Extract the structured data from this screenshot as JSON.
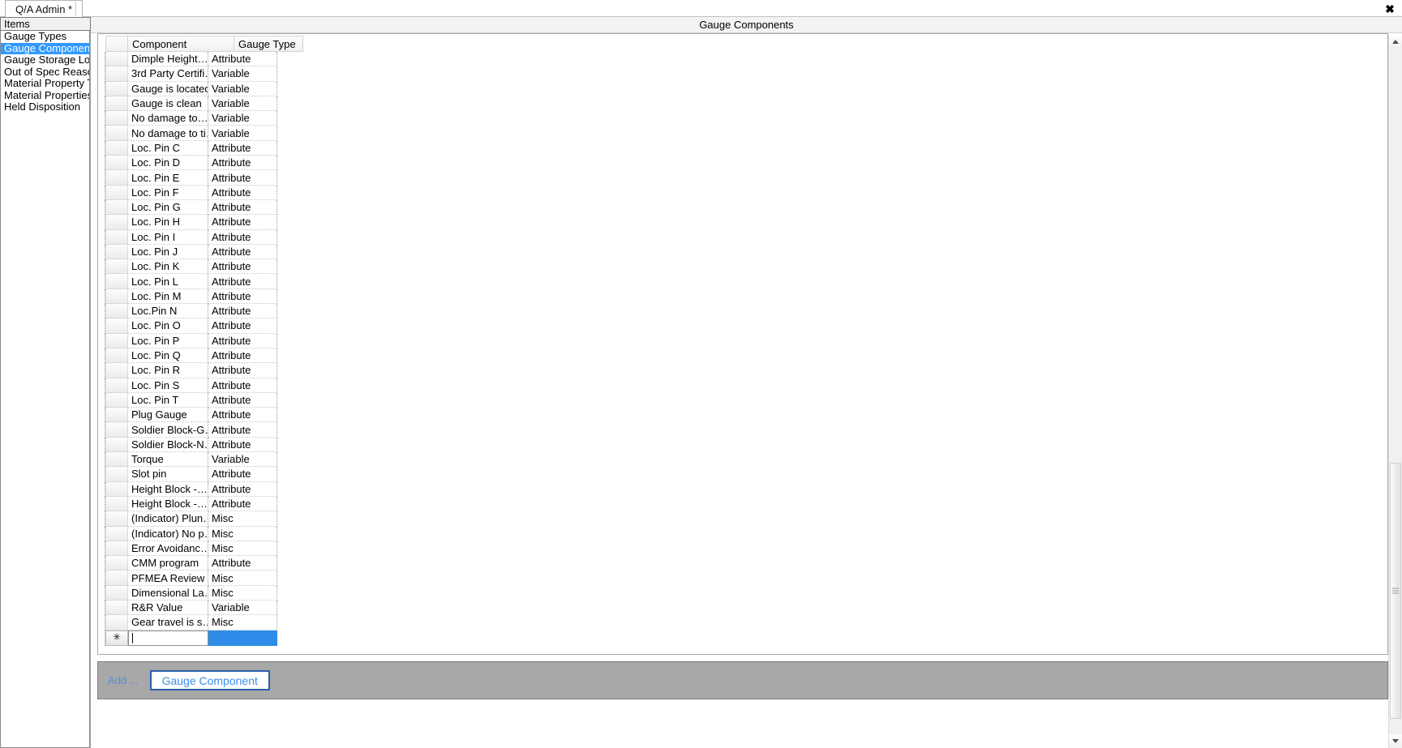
{
  "window": {
    "app_tab_label": "Q/A Admin *",
    "close_icon": "close-icon"
  },
  "sidebar": {
    "header": "Items",
    "items": [
      {
        "label": "Gauge Types",
        "selected": false
      },
      {
        "label": "Gauge Components",
        "selected": true
      },
      {
        "label": "Gauge Storage Loc",
        "selected": false
      },
      {
        "label": "Out of Spec Reason",
        "selected": false
      },
      {
        "label": "Material Property Ty",
        "selected": false
      },
      {
        "label": "Material Properties",
        "selected": false
      },
      {
        "label": "Held Disposition",
        "selected": false
      }
    ]
  },
  "main": {
    "title": "Gauge Components",
    "grid": {
      "columns": [
        "Component",
        "Gauge Type"
      ],
      "rows": [
        {
          "component": "Dimple  Height…",
          "gauge_type": "Attribute"
        },
        {
          "component": "3rd Party  Certifi…",
          "gauge_type": "Variable"
        },
        {
          "component": "Gauge is located",
          "gauge_type": "Variable"
        },
        {
          "component": "Gauge is clean",
          "gauge_type": "Variable"
        },
        {
          "component": "No damage  to…",
          "gauge_type": "Variable"
        },
        {
          "component": "No damage to ti…",
          "gauge_type": "Variable"
        },
        {
          "component": "Loc. Pin C",
          "gauge_type": "Attribute"
        },
        {
          "component": "Loc. Pin D",
          "gauge_type": "Attribute"
        },
        {
          "component": "Loc. Pin E",
          "gauge_type": "Attribute"
        },
        {
          "component": "Loc. Pin F",
          "gauge_type": "Attribute"
        },
        {
          "component": "Loc. Pin G",
          "gauge_type": "Attribute"
        },
        {
          "component": "Loc. Pin H",
          "gauge_type": "Attribute"
        },
        {
          "component": "Loc. Pin I",
          "gauge_type": "Attribute"
        },
        {
          "component": "Loc. Pin J",
          "gauge_type": "Attribute"
        },
        {
          "component": "Loc. Pin K",
          "gauge_type": "Attribute"
        },
        {
          "component": "Loc. Pin L",
          "gauge_type": "Attribute"
        },
        {
          "component": "Loc. Pin M",
          "gauge_type": "Attribute"
        },
        {
          "component": "Loc.Pin N",
          "gauge_type": "Attribute"
        },
        {
          "component": "Loc. Pin O",
          "gauge_type": "Attribute"
        },
        {
          "component": "Loc. Pin P",
          "gauge_type": "Attribute"
        },
        {
          "component": "Loc. Pin Q",
          "gauge_type": "Attribute"
        },
        {
          "component": "Loc. Pin R",
          "gauge_type": "Attribute"
        },
        {
          "component": "Loc. Pin S",
          "gauge_type": "Attribute"
        },
        {
          "component": "Loc. Pin T",
          "gauge_type": "Attribute"
        },
        {
          "component": "Plug Gauge",
          "gauge_type": "Attribute"
        },
        {
          "component": "Soldier  Block-G…",
          "gauge_type": "Attribute"
        },
        {
          "component": "Soldier  Block-N…",
          "gauge_type": "Attribute"
        },
        {
          "component": "Torque",
          "gauge_type": "Variable"
        },
        {
          "component": "Slot pin",
          "gauge_type": "Attribute"
        },
        {
          "component": "Height  Block -…",
          "gauge_type": "Attribute"
        },
        {
          "component": "Height  Block -…",
          "gauge_type": "Attribute"
        },
        {
          "component": "(Indicator)  Plun…",
          "gauge_type": "Misc"
        },
        {
          "component": "(Indicator)  No p…",
          "gauge_type": "Misc"
        },
        {
          "component": "Error  Avoidanc…",
          "gauge_type": "Misc"
        },
        {
          "component": "CMM program",
          "gauge_type": "Attribute"
        },
        {
          "component": "PFMEA Review",
          "gauge_type": "Misc"
        },
        {
          "component": "Dimensional  La…",
          "gauge_type": "Misc"
        },
        {
          "component": "R&R Value",
          "gauge_type": "Variable"
        },
        {
          "component": "Gear travel is s…",
          "gauge_type": "Misc"
        }
      ],
      "new_row": {
        "marker_icon": "new-row-asterisk-icon",
        "component_value": "",
        "component_placeholder": ""
      }
    }
  },
  "bottom": {
    "add_label": "Add ...",
    "gauge_component_button": "Gauge Component"
  },
  "scrollbar": {
    "up_icon": "scroll-up-arrow-icon",
    "down_icon": "scroll-down-arrow-icon",
    "thumb": "scroll-thumb"
  },
  "colors": {
    "selection_blue": "#3399ff",
    "cell_blue": "#2e8ce8",
    "button_text_blue": "#3a8ee6",
    "bottom_bar_gray": "#a8a8a8"
  }
}
